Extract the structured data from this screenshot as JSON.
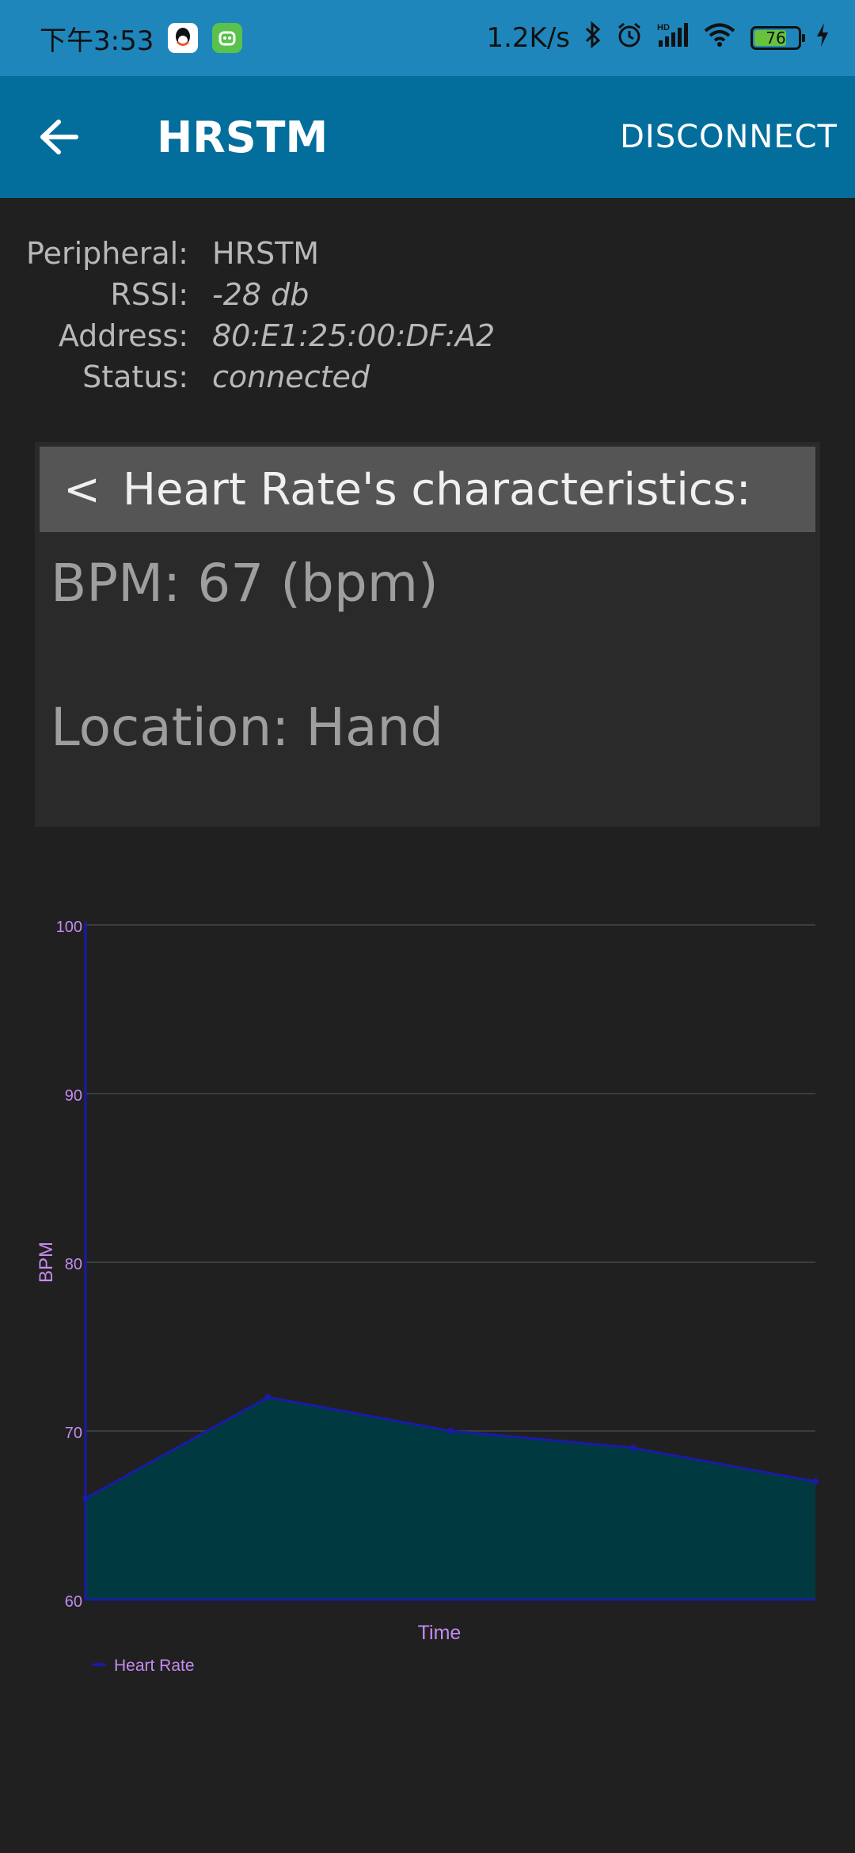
{
  "status_bar": {
    "time": "下午3:53",
    "net_speed": "1.2K/s",
    "battery": "76",
    "battery_level": 0.76,
    "icons": [
      "qq-icon",
      "app-icon",
      "bluetooth-icon",
      "alarm-icon",
      "hd-signal-icon",
      "wifi-icon",
      "battery-icon",
      "charging-icon"
    ]
  },
  "appbar": {
    "title": "HRSTM",
    "disconnect_label": "DISCONNECT",
    "back_icon": "arrow-left-icon"
  },
  "info": {
    "peripheral_label": "Peripheral:",
    "peripheral_value": "HRSTM",
    "rssi_label": "RSSI:",
    "rssi_value": "-28 db",
    "address_label": "Address:",
    "address_value": "80:E1:25:00:DF:A2",
    "status_label": "Status:",
    "status_value": "connected"
  },
  "card": {
    "header_chevron": "<",
    "header_title": "Heart Rate's characteristics:",
    "bpm_line": "BPM: 67 (bpm)",
    "location_line": "Location: Hand"
  },
  "chart_data": {
    "type": "area",
    "x": [
      1,
      2,
      3,
      4,
      5
    ],
    "series": [
      {
        "name": "Heart Rate",
        "values": [
          66,
          72,
          70,
          69,
          67
        ]
      }
    ],
    "ylabel": "BPM",
    "xlabel": "Time",
    "ylim": [
      60,
      100
    ],
    "yticks": [
      60,
      70,
      80,
      90,
      100
    ],
    "grid": true,
    "legend": "bottom-left",
    "colors": {
      "line": "#1a1aa8",
      "fill": "#003a40",
      "tick_text": "#c58bf0",
      "grid": "#3c3c3c",
      "axis": "#1a1aa8"
    }
  }
}
